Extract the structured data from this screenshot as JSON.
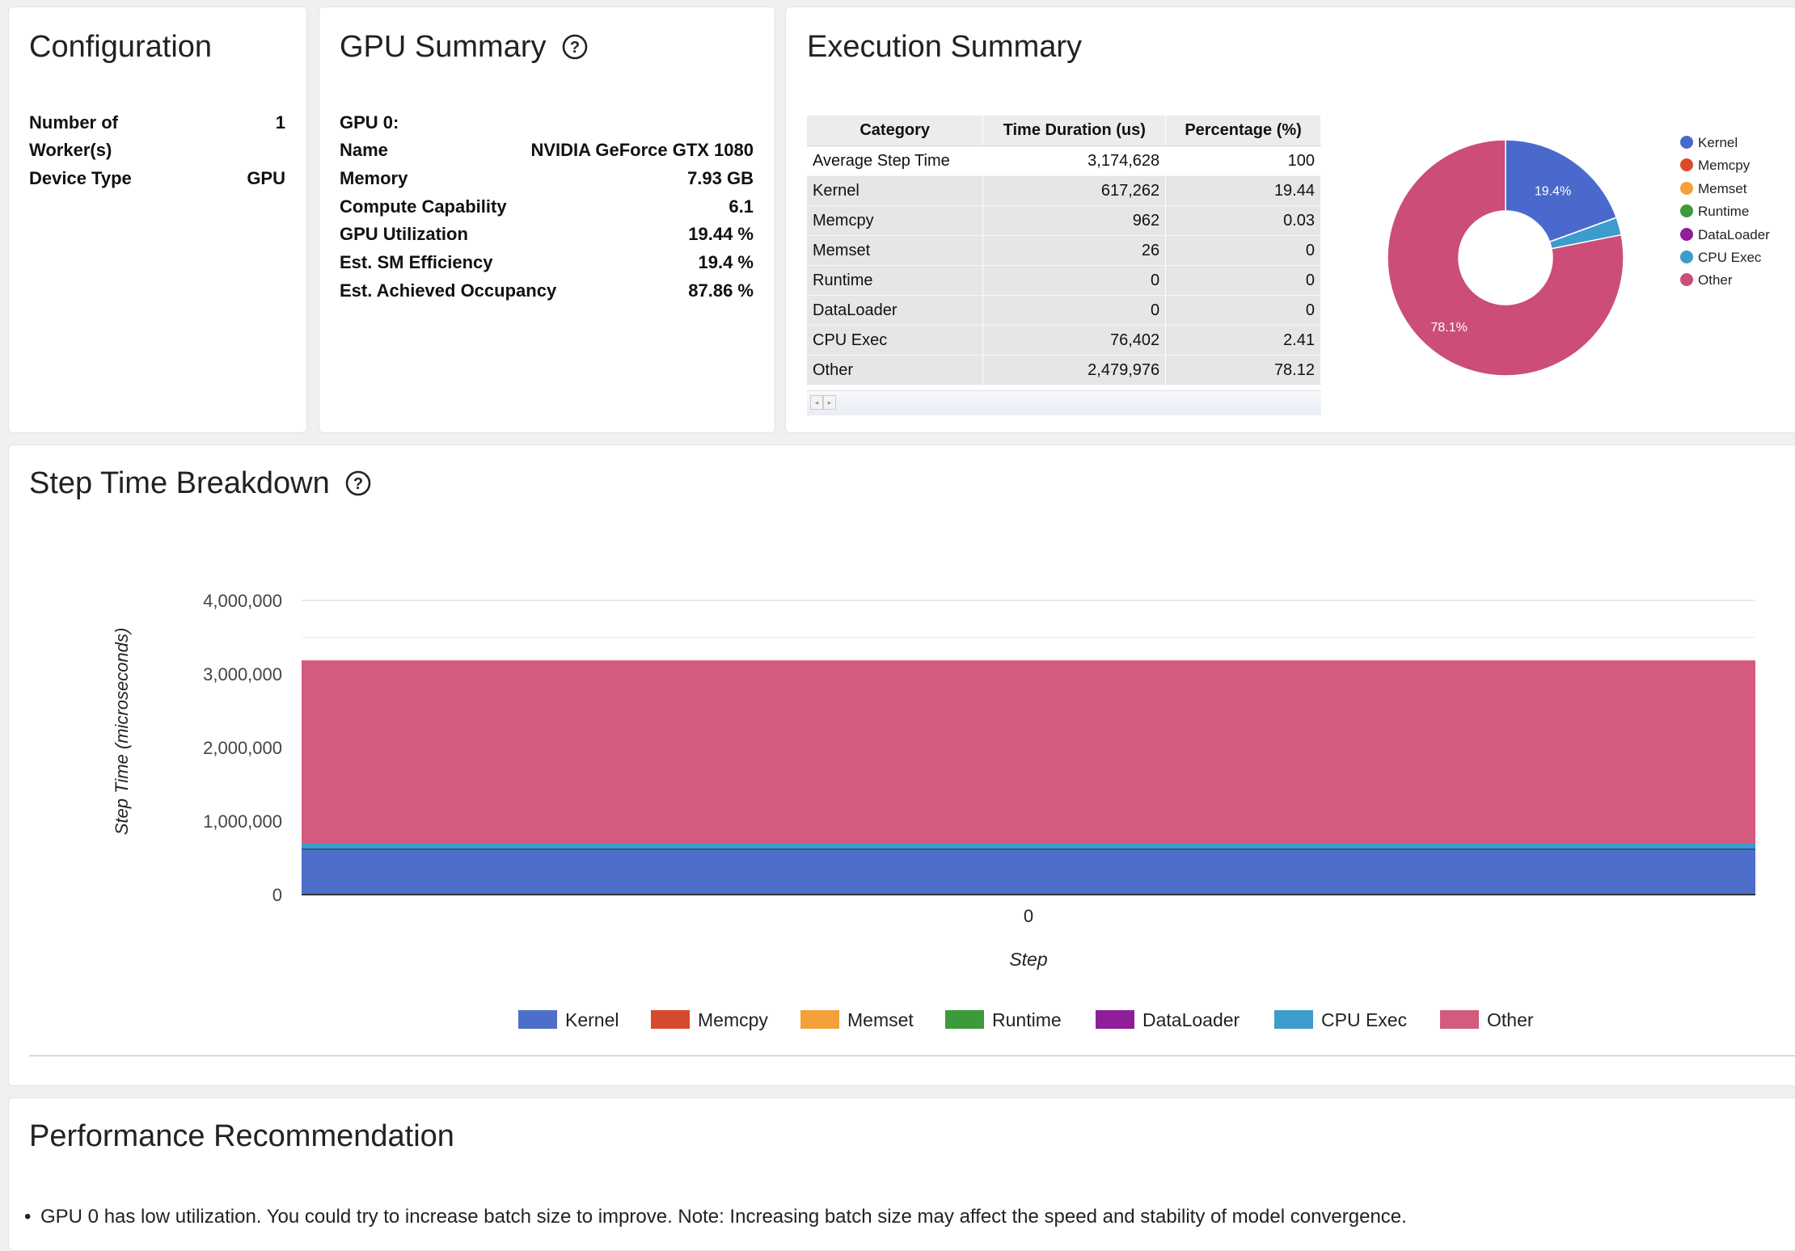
{
  "configuration": {
    "title": "Configuration",
    "rows": [
      {
        "label_line1": "Number of",
        "label_line2": "Worker(s)",
        "value": "1"
      },
      {
        "label": "Device Type",
        "value": "GPU"
      }
    ]
  },
  "gpu_summary": {
    "title": "GPU Summary",
    "help_icon": "question-circle-icon",
    "gpu_header": "GPU 0:",
    "rows": [
      {
        "label": "Name",
        "value": "NVIDIA GeForce GTX 1080"
      },
      {
        "label": "Memory",
        "value": "7.93 GB"
      },
      {
        "label": "Compute Capability",
        "value": "6.1"
      },
      {
        "label": "GPU Utilization",
        "value": "19.44 %"
      },
      {
        "label": "Est. SM Efficiency",
        "value": "19.4 %"
      },
      {
        "label": "Est. Achieved Occupancy",
        "value": "87.86 %"
      }
    ]
  },
  "execution_summary": {
    "title": "Execution Summary",
    "table": {
      "headers": [
        "Category",
        "Time Duration (us)",
        "Percentage (%)"
      ],
      "rows": [
        [
          "Average Step Time",
          "3,174,628",
          "100"
        ],
        [
          "Kernel",
          "617,262",
          "19.44"
        ],
        [
          "Memcpy",
          "962",
          "0.03"
        ],
        [
          "Memset",
          "26",
          "0"
        ],
        [
          "Runtime",
          "0",
          "0"
        ],
        [
          "DataLoader",
          "0",
          "0"
        ],
        [
          "CPU Exec",
          "76,402",
          "2.41"
        ],
        [
          "Other",
          "2,479,976",
          "78.12"
        ]
      ]
    },
    "pie": {
      "slices": [
        {
          "name": "Kernel",
          "value": 617262,
          "color": "#4a69cc"
        },
        {
          "name": "Memcpy",
          "value": 962,
          "color": "#dc4a2a"
        },
        {
          "name": "Memset",
          "value": 26,
          "color": "#f4a03a"
        },
        {
          "name": "Runtime",
          "value": 0,
          "color": "#3c9a3a"
        },
        {
          "name": "DataLoader",
          "value": 0,
          "color": "#8e1e99"
        },
        {
          "name": "CPU Exec",
          "value": 76402,
          "color": "#3c9ccc"
        },
        {
          "name": "Other",
          "value": 2479976,
          "color": "#cc4d78"
        }
      ],
      "labels": {
        "Kernel": "19.4%",
        "Other": "78.1%"
      }
    }
  },
  "step_time": {
    "title": "Step Time Breakdown",
    "help_icon": "question-circle-icon",
    "legend": [
      "Kernel",
      "Memcpy",
      "Memset",
      "Runtime",
      "DataLoader",
      "CPU Exec",
      "Other"
    ]
  },
  "chart_data": {
    "type": "area",
    "title": "",
    "xlabel": "Step",
    "ylabel": "Step Time (microseconds)",
    "categories": [
      "0"
    ],
    "ylim": [
      0,
      4000000
    ],
    "yticks": [
      "0",
      "1,000,000",
      "2,000,000",
      "3,000,000",
      "4,000,000"
    ],
    "stacked": true,
    "legend_position": "bottom",
    "series": [
      {
        "name": "Kernel",
        "values": [
          617262
        ],
        "color": "#4d6ecb"
      },
      {
        "name": "Memcpy",
        "values": [
          962
        ],
        "color": "#d44a2c"
      },
      {
        "name": "Memset",
        "values": [
          26
        ],
        "color": "#f4a03a"
      },
      {
        "name": "Runtime",
        "values": [
          0
        ],
        "color": "#3c9a3a"
      },
      {
        "name": "DataLoader",
        "values": [
          0
        ],
        "color": "#8e1e99"
      },
      {
        "name": "CPU Exec",
        "values": [
          76402
        ],
        "color": "#3d9ccc"
      },
      {
        "name": "Other",
        "values": [
          2479976
        ],
        "color": "#d45b7e"
      }
    ]
  },
  "performance": {
    "title": "Performance Recommendation",
    "items": [
      "GPU 0 has low utilization. You could try to increase batch size to improve. Note: Increasing batch size may affect the speed and stability of model convergence."
    ]
  }
}
